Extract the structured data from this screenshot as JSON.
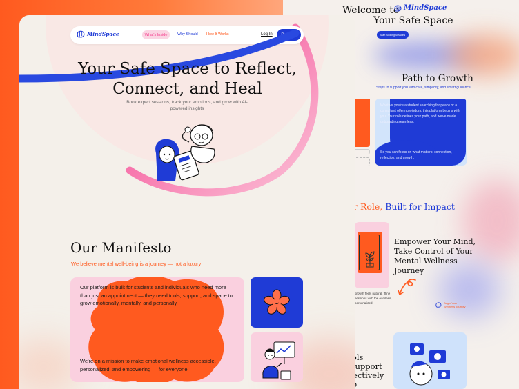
{
  "brand": {
    "name": "MindSpace",
    "primary": "#1f3bd6",
    "accent": "#ff5a1f",
    "pink": "#f43b8c"
  },
  "nav": {
    "items": [
      {
        "label": "What's Inside"
      },
      {
        "label": "Why Should"
      },
      {
        "label": "How It Works"
      }
    ],
    "login": "Log In",
    "register": "Register"
  },
  "hero": {
    "title_line1": "Your Safe Space to Reflect,",
    "title_line2": "Connect, and Heal",
    "subtitle": "Book expert sessions, track your emotions, and grow with AI-powered insights"
  },
  "manifesto": {
    "title": "Our Manifesto",
    "tagline": "We believe mental well-being is a journey — not a luxury",
    "paragraph1": "Our platform is built for students and individuals who need more than just an appointment — they need tools, support, and space to grow emotionally, mentally, and personally.",
    "paragraph2": "We're on a mission to make emotional wellness accessible, personalized, and empowering — for everyone."
  },
  "preview": {
    "welcome": "Welcome to",
    "welcome_line2": "Your Safe Space",
    "booking_button": "Start Booking Sessions",
    "path_title": "Path to Growth",
    "path_subtitle": "Steps to support you with care, simplicity, and smart guidance",
    "path_text1": "Whether you're a student searching for peace or a consultant offering wisdom, this platform begins with you. Your role defines your path, and we've made onboarding seamless.",
    "path_text2": "So you can focus on what matters: connection, reflection, and growth.",
    "role_prefix": "r Role,",
    "role_suffix": "Built for Impact",
    "empower_title": "Empower Your Mind, Take Control of Your Mental Wellness Journey",
    "growth_note": "growth feels natural. ffline sessions with the eamless, personalized",
    "begin_label": "Begin Your Wellness Journey",
    "tools_title": "ools\n Support\nffectively\nep"
  }
}
